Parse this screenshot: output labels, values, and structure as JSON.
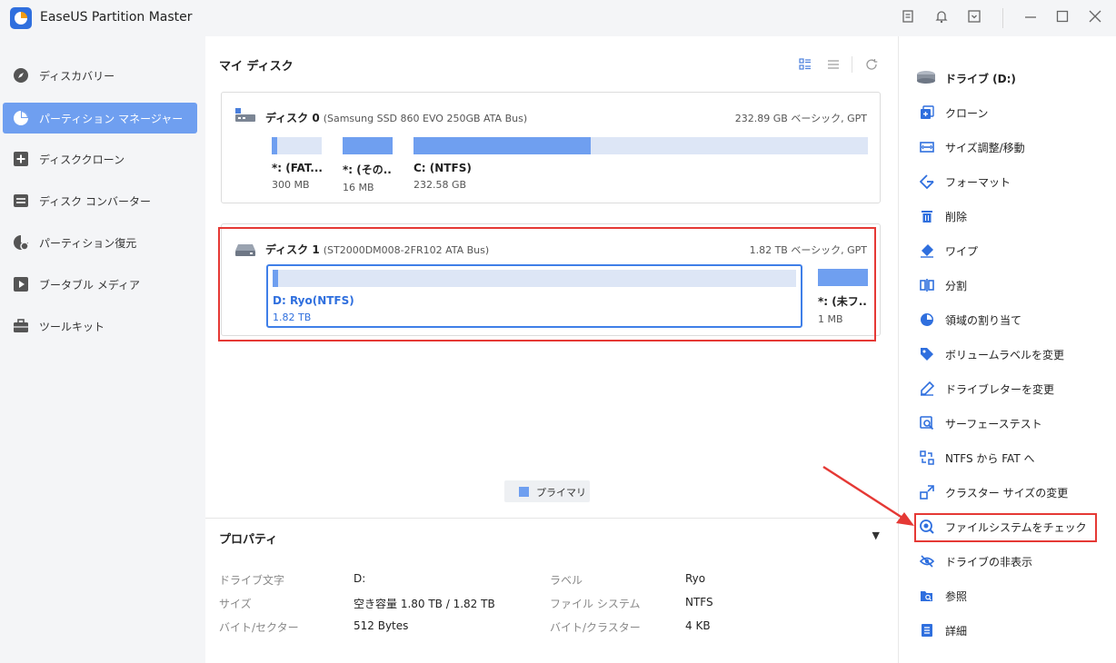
{
  "app": {
    "title": "EaseUS Partition Master"
  },
  "titlebar_icons": [
    "note-icon",
    "bell-icon",
    "dropdown-box-icon",
    "minimize-icon",
    "maximize-icon",
    "close-icon"
  ],
  "sidebar": {
    "items": [
      {
        "label": "ディスカバリー",
        "icon": "compass-icon",
        "active": false
      },
      {
        "label": "パーティション マネージャー",
        "icon": "pie-chart-icon",
        "active": true
      },
      {
        "label": "ディスククローン",
        "icon": "clone-plus-icon",
        "active": false
      },
      {
        "label": "ディスク コンバーター",
        "icon": "convert-icon",
        "active": false
      },
      {
        "label": "パーティション復元",
        "icon": "recovery-icon",
        "active": false
      },
      {
        "label": "ブータブル メディア",
        "icon": "boot-media-icon",
        "active": false
      },
      {
        "label": "ツールキット",
        "icon": "toolkit-icon",
        "active": false
      }
    ]
  },
  "main": {
    "title": "マイ ディスク",
    "disks": [
      {
        "name": "ディスク 0",
        "model": "(Samsung SSD 860 EVO 250GB ATA Bus)",
        "info": "232.89 GB ベーシック, GPT",
        "partitions": [
          {
            "name": "*: (FAT...",
            "size": "300 MB",
            "used_fraction": 0.1
          },
          {
            "name": "*: (その...",
            "size": "16 MB",
            "used_fraction": 1.0
          },
          {
            "name": "C: (NTFS)",
            "size": "232.58 GB",
            "used_fraction": 0.39
          }
        ]
      },
      {
        "name": "ディスク 1",
        "model": "(ST2000DM008-2FR102 ATA Bus)",
        "info": "1.82 TB ベーシック, GPT",
        "partitions": [
          {
            "name": "D: Ryo(NTFS)",
            "size": "1.82 TB",
            "used_fraction": 0.01,
            "selected": true
          },
          {
            "name": "*: (未フ...",
            "size": "1 MB",
            "used_fraction": 1.0
          }
        ]
      }
    ],
    "legend": {
      "label": "プライマリ",
      "color": "#6f9ff0"
    }
  },
  "properties": {
    "title": "プロパティ",
    "rows": [
      {
        "label1": "ドライブ文字",
        "value1": "D:",
        "label2": "ラベル",
        "value2": "Ryo"
      },
      {
        "label1": "サイズ",
        "value1": "空き容量 1.80 TB / 1.82 TB",
        "label2": "ファイル システム",
        "value2": "NTFS"
      },
      {
        "label1": "バイト/セクター",
        "value1": "512 Bytes",
        "label2": "バイト/クラスター",
        "value2": "4 KB"
      }
    ]
  },
  "right_panel": {
    "drive_label": "ドライブ (D:)",
    "actions": [
      {
        "label": "クローン",
        "icon": "clone-icon"
      },
      {
        "label": "サイズ調整/移動",
        "icon": "resize-icon"
      },
      {
        "label": "フォーマット",
        "icon": "format-icon"
      },
      {
        "label": "削除",
        "icon": "trash-icon"
      },
      {
        "label": "ワイプ",
        "icon": "eraser-icon"
      },
      {
        "label": "分割",
        "icon": "split-icon"
      },
      {
        "label": "領域の割り当て",
        "icon": "allocate-icon"
      },
      {
        "label": "ボリュームラベルを変更",
        "icon": "tag-icon"
      },
      {
        "label": "ドライブレターを変更",
        "icon": "edit-letter-icon"
      },
      {
        "label": "サーフェーステスト",
        "icon": "surface-test-icon"
      },
      {
        "label": "NTFS から FAT へ",
        "icon": "convert-fs-icon"
      },
      {
        "label": "クラスター サイズの変更",
        "icon": "cluster-icon"
      },
      {
        "label": "ファイルシステムをチェック",
        "icon": "check-fs-icon",
        "highlighted": true
      },
      {
        "label": "ドライブの非表示",
        "icon": "hide-icon"
      },
      {
        "label": "参照",
        "icon": "browse-icon"
      },
      {
        "label": "詳細",
        "icon": "details-icon"
      }
    ]
  },
  "colors": {
    "accent": "#6f9ff0",
    "highlight": "#e53935",
    "bar_bg": "#dde6f6"
  }
}
